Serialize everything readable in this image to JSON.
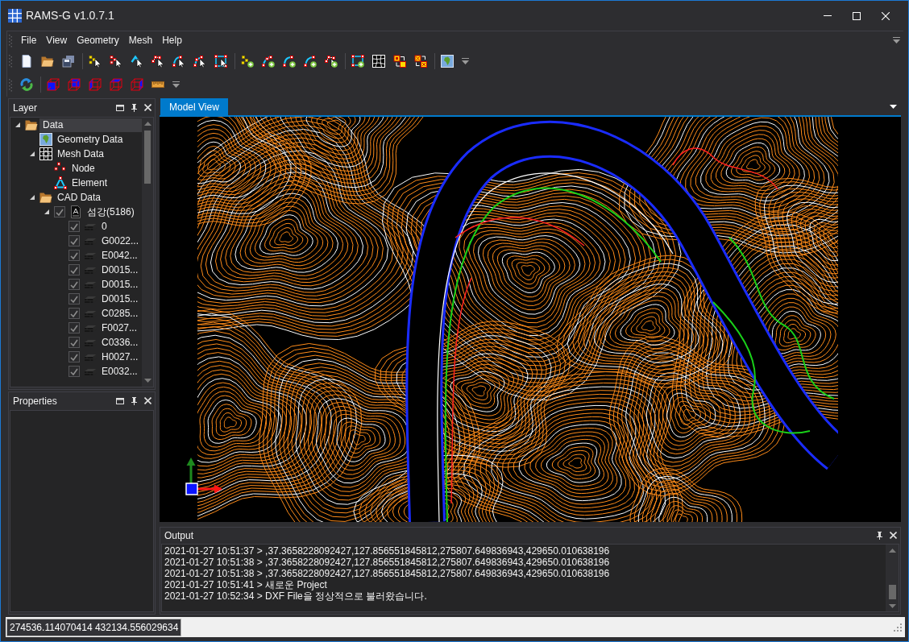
{
  "window": {
    "title": "RAMS-G v1.0.7.1"
  },
  "menu": [
    "File",
    "View",
    "Geometry",
    "Mesh",
    "Help"
  ],
  "layer_panel": {
    "title": "Layer",
    "tree": [
      {
        "label": "Data",
        "kind": "folder",
        "expanded": true,
        "selected": true,
        "children": [
          {
            "label": "Geometry Data",
            "kind": "map",
            "selected": false
          },
          {
            "label": "Mesh Data",
            "kind": "mesh",
            "expanded": true,
            "selected": false,
            "children": [
              {
                "label": "Node",
                "kind": "node",
                "selected": false
              },
              {
                "label": "Element",
                "kind": "element",
                "selected": false
              }
            ]
          },
          {
            "label": "CAD Data",
            "kind": "folder",
            "expanded": true,
            "selected": false,
            "children": [
              {
                "label": "섬강(5186)",
                "kind": "cad_file",
                "checked": true,
                "expanded": true,
                "selected": false,
                "children": [
                  {
                    "label": "0",
                    "kind": "layer",
                    "checked": true,
                    "selected": false
                  },
                  {
                    "label": "G0022...",
                    "kind": "layer",
                    "checked": true,
                    "selected": false
                  },
                  {
                    "label": "E0042...",
                    "kind": "layer",
                    "checked": true,
                    "selected": false
                  },
                  {
                    "label": "D0015...",
                    "kind": "layer",
                    "checked": true,
                    "selected": false
                  },
                  {
                    "label": "D0015...",
                    "kind": "layer",
                    "checked": true,
                    "selected": false
                  },
                  {
                    "label": "D0015...",
                    "kind": "layer",
                    "checked": true,
                    "selected": false
                  },
                  {
                    "label": "C0285...",
                    "kind": "layer",
                    "checked": true,
                    "selected": false
                  },
                  {
                    "label": "F0027...",
                    "kind": "layer",
                    "checked": true,
                    "selected": false
                  },
                  {
                    "label": "C0336...",
                    "kind": "layer",
                    "checked": true,
                    "selected": false
                  },
                  {
                    "label": "H0027...",
                    "kind": "layer",
                    "checked": true,
                    "selected": false
                  },
                  {
                    "label": "E0032...",
                    "kind": "layer",
                    "checked": true,
                    "selected": false
                  }
                ]
              }
            ]
          }
        ]
      }
    ]
  },
  "properties_panel": {
    "title": "Properties"
  },
  "document_tabs": [
    {
      "label": "Model View",
      "selected": true
    }
  ],
  "output_panel": {
    "title": "Output",
    "lines": [
      "2021-01-27 10:51:37 > ,37.3658228092427,127.856551845812,275807.649836943,429650.010638196",
      "2021-01-27 10:51:38 > ,37.3658228092427,127.856551845812,275807.649836943,429650.010638196",
      "2021-01-27 10:51:38 > ,37.3658228092427,127.856551845812,275807.649836943,429650.010638196",
      "2021-01-27 10:51:41 > 새로운 Project",
      "2021-01-27 10:52:34 > DXF File을 정상적으로 불러왔습니다."
    ]
  },
  "status_bar": {
    "coordinates": "274536.114070414 432134.556029634"
  }
}
